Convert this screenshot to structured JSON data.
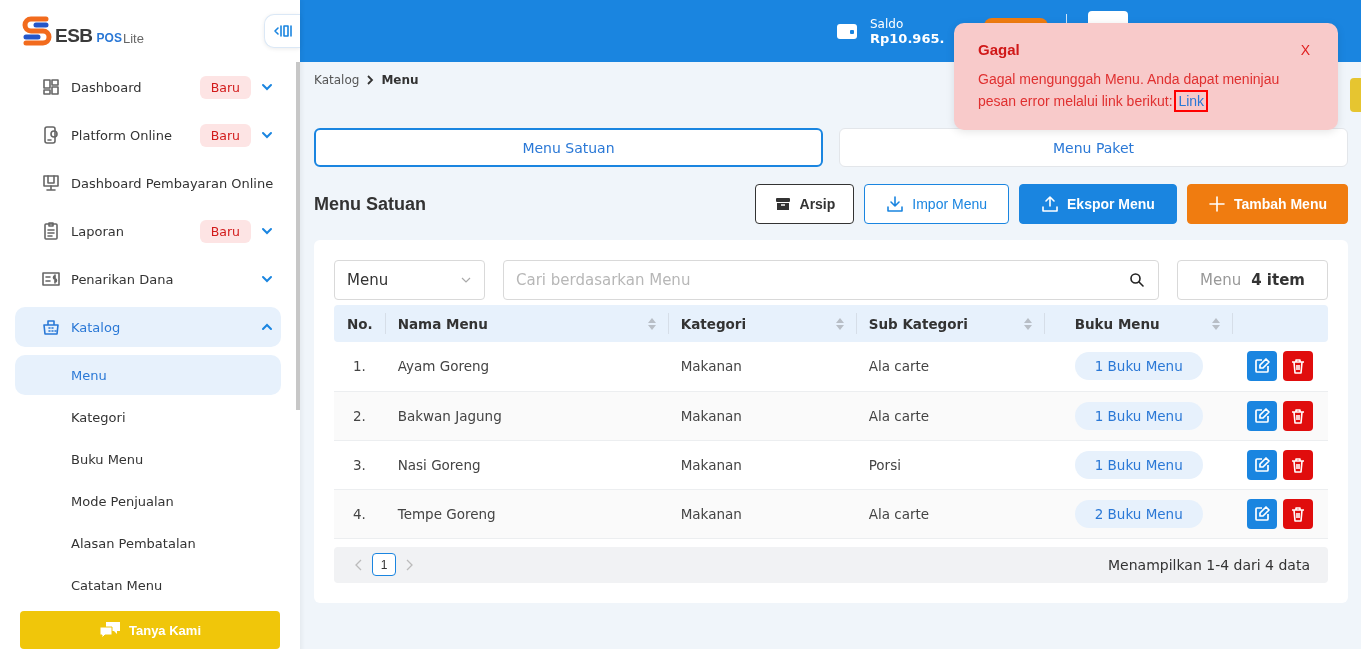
{
  "sidebar": {
    "logo": {
      "brand": "ESB",
      "product": "POS",
      "edition": "Lite"
    },
    "items": [
      {
        "label": "Dashboard",
        "badge": "Baru",
        "expanded": false,
        "selected": false
      },
      {
        "label": "Platform Online",
        "badge": "Baru",
        "expanded": false,
        "selected": false
      },
      {
        "label": "Dashboard Pembayaran Online",
        "selected": false
      },
      {
        "label": "Laporan",
        "badge": "Baru",
        "expanded": false,
        "selected": false
      },
      {
        "label": "Penarikan Dana",
        "expanded": false,
        "selected": false
      },
      {
        "label": "Katalog",
        "expanded": true,
        "selected": true,
        "children": [
          {
            "label": "Menu",
            "selected": true
          },
          {
            "label": "Kategori",
            "selected": false
          },
          {
            "label": "Buku Menu",
            "selected": false
          },
          {
            "label": "Mode Penjualan",
            "selected": false
          },
          {
            "label": "Alasan Pembatalan",
            "selected": false
          },
          {
            "label": "Catatan Menu",
            "selected": false
          }
        ]
      }
    ],
    "help_button": "Tanya Kami"
  },
  "header": {
    "balance_label": "Saldo",
    "balance": "Rp10.965."
  },
  "breadcrumb": [
    {
      "label": "Katalog",
      "current": false
    },
    {
      "label": "Menu",
      "current": true
    }
  ],
  "tabs": [
    {
      "label": "Menu Satuan",
      "selected": true
    },
    {
      "label": "Menu Paket",
      "selected": false
    }
  ],
  "section_title": "Menu Satuan",
  "actions": [
    {
      "label": "Arsip",
      "kind": "archive"
    },
    {
      "label": "Impor Menu",
      "kind": "import"
    },
    {
      "label": "Ekspor Menu",
      "kind": "export"
    },
    {
      "label": "Tambah Menu",
      "kind": "add"
    }
  ],
  "filter": {
    "field": "Menu",
    "search_placeholder": "Cari berdasarkan Menu",
    "count_label": "Menu",
    "count": "4 item"
  },
  "table": {
    "columns": [
      {
        "label": "No.",
        "sortable": false
      },
      {
        "label": "Nama Menu",
        "sortable": true
      },
      {
        "label": "Kategori",
        "sortable": true
      },
      {
        "label": "Sub Kategori",
        "sortable": true
      },
      {
        "label": "Buku Menu",
        "sortable": true
      }
    ],
    "rows": [
      {
        "no": "1.",
        "name": "Ayam Goreng",
        "category": "Makanan",
        "sub_category": "Ala carte",
        "menu_books": "1 Buku Menu"
      },
      {
        "no": "2.",
        "name": "Bakwan Jagung",
        "category": "Makanan",
        "sub_category": "Ala carte",
        "menu_books": "1 Buku Menu"
      },
      {
        "no": "3.",
        "name": "Nasi Goreng",
        "category": "Makanan",
        "sub_category": "Porsi",
        "menu_books": "1 Buku Menu"
      },
      {
        "no": "4.",
        "name": "Tempe Goreng",
        "category": "Makanan",
        "sub_category": "Ala carte",
        "menu_books": "2 Buku Menu"
      }
    ]
  },
  "pagination": {
    "pages": [
      {
        "label": "1",
        "selected": true
      }
    ],
    "summary": "Menampilkan 1-4 dari 4 data"
  },
  "toast": {
    "title": "Gagal",
    "message": "Gagal mengunggah Menu. Anda dapat meninjau pesan error melalui link berikut:",
    "link": "Link",
    "link_highlighted": true,
    "close": "X"
  }
}
